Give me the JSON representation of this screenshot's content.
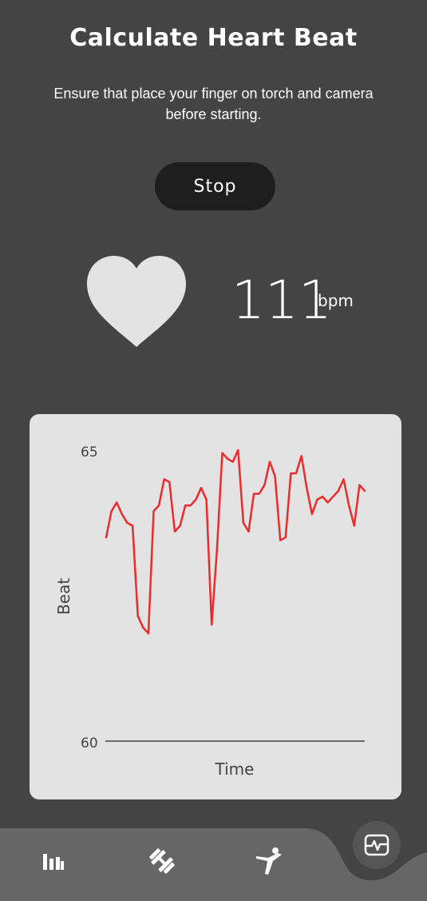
{
  "header": {
    "title": "Calculate Heart Beat",
    "instruction": "Ensure that place your finger on torch and camera before starting."
  },
  "controls": {
    "stop_label": "Stop"
  },
  "reading": {
    "value": "111",
    "unit": "bpm"
  },
  "chart_data": {
    "type": "line",
    "xlabel": "Time",
    "ylabel": "Beat",
    "ylim": [
      60,
      65
    ],
    "y_ticks": [
      "65",
      "60"
    ],
    "color": "#ee2a2a",
    "values": [
      63.5,
      63.95,
      64.1,
      63.9,
      63.75,
      63.7,
      62.15,
      61.95,
      61.85,
      63.95,
      64.05,
      64.5,
      64.45,
      63.6,
      63.7,
      64.05,
      64.05,
      64.15,
      64.35,
      64.15,
      62.0,
      63.3,
      64.95,
      64.85,
      64.8,
      65.0,
      63.75,
      63.6,
      64.25,
      64.25,
      64.4,
      64.8,
      64.55,
      63.45,
      63.5,
      64.6,
      64.6,
      64.9,
      64.35,
      63.9,
      64.15,
      64.2,
      64.1,
      64.2,
      64.3,
      64.5,
      64.05,
      63.7,
      64.4,
      64.3
    ]
  },
  "bottom_nav": {
    "items": [
      {
        "name": "stats",
        "icon": "bar-chart-icon"
      },
      {
        "name": "workout",
        "icon": "dumbbell-icon"
      },
      {
        "name": "yoga",
        "icon": "yoga-pose-icon"
      },
      {
        "name": "heart-rate",
        "icon": "pulse-monitor-icon",
        "active": true
      }
    ],
    "bar_color": "#666666",
    "active_color": "#555555"
  }
}
